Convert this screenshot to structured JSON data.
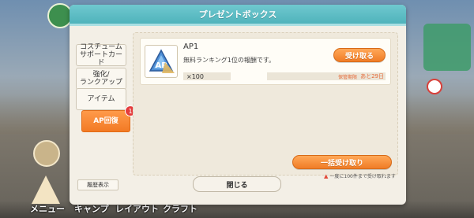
{
  "dialog": {
    "title": "プレゼントボックス",
    "tabs": [
      {
        "label": "コスチューム\nサポートカード",
        "active": false
      },
      {
        "label": "強化/\nランクアップ",
        "active": false
      },
      {
        "label": "アイテム",
        "active": false
      },
      {
        "label": "AP回復",
        "active": true,
        "badge": "1"
      }
    ],
    "item": {
      "title": "AP1",
      "description": "無料ランキング1位の報酬です。",
      "quantity": "×100",
      "expire_label": "保管期限",
      "expire_value": "あと29日",
      "receive_label": "受け取る",
      "icon_text": "AP"
    },
    "bulk_receive_label": "一括受け取り",
    "warning_text": "一度に100件まで受け取れます",
    "history_label": "履歴表示",
    "close_label": "閉じる"
  },
  "bottom_nav": {
    "menu": "メニュー",
    "camp": "キャンプ",
    "layout": "レイアウト",
    "craft": "クラフト"
  }
}
